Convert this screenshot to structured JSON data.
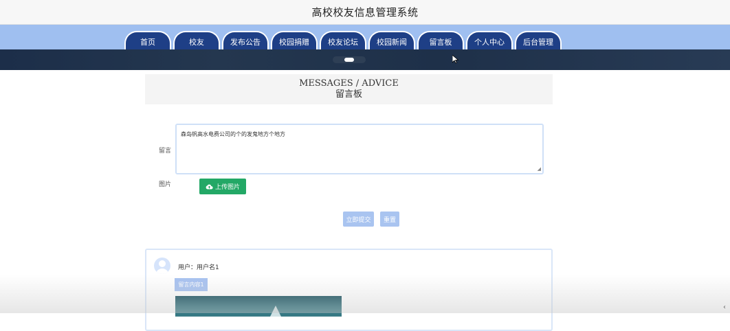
{
  "header": {
    "title": "高校校友信息管理系统"
  },
  "nav": {
    "items": [
      "首页",
      "校友",
      "发布公告",
      "校园捐赠",
      "校友论坛",
      "校园新闻",
      "留言板",
      "个人中心",
      "后台管理"
    ]
  },
  "section": {
    "title_en": "MESSAGES / ADVICE",
    "title_cn": "留言板"
  },
  "form": {
    "message_label": "留言",
    "message_value": "森岛帆高水电费公司的个的发鬼地方个地方",
    "image_label": "图片",
    "upload_label": "上传图片",
    "submit_label": "立即提交",
    "reset_label": "重置"
  },
  "messages": [
    {
      "user_line": "用户：用户名1",
      "content": "留言内容1"
    }
  ],
  "colors": {
    "nav_tab": "#1e3f86",
    "nav_band": "#9fbff0",
    "upload": "#23a866",
    "button_blue": "#a9c4f0"
  }
}
